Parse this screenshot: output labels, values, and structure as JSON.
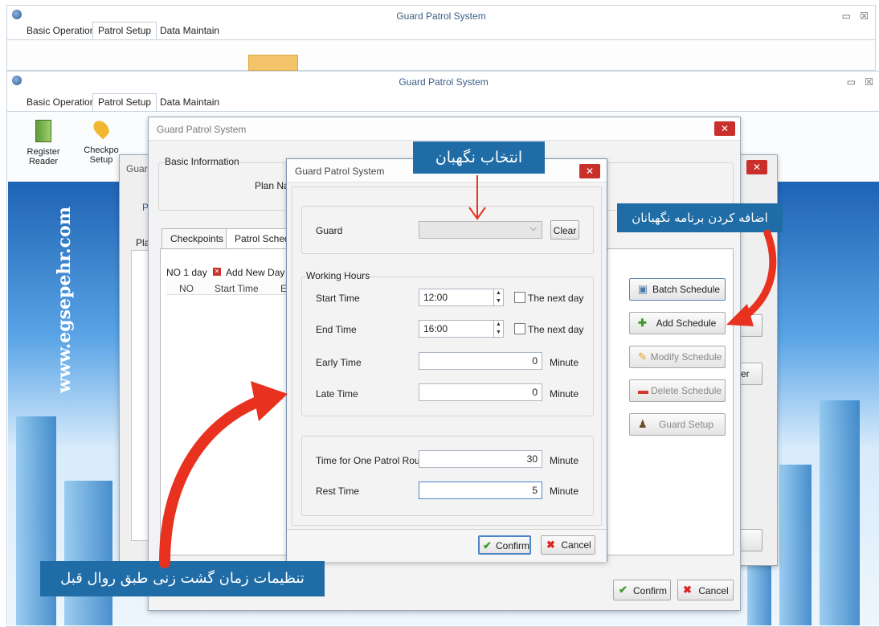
{
  "window_back": {
    "title": "Guard Patrol System",
    "menu": [
      "Basic Operation",
      "Patrol Setup",
      "Data Maintain"
    ]
  },
  "window_main": {
    "title": "Guard Patrol System",
    "menu": [
      "Basic Operation",
      "Patrol Setup",
      "Data Maintain"
    ],
    "ribbon": [
      {
        "label": "Register\nReader",
        "icon": "reader-icon"
      },
      {
        "label": "Checkpoint\nSetup",
        "icon": "checkpoint-pin-icon"
      }
    ],
    "ribbon_partial": [
      "Register",
      "Checkpo",
      "Reader",
      "Setup"
    ]
  },
  "plan_dialog": {
    "title": "Guard Patrol System",
    "basic_info_label": "Basic Information",
    "plan_name_label": "Plan Nar",
    "tabs": [
      "Checkpoints",
      "Patrol Schedu"
    ],
    "sched_tab_label": "NO 1 day",
    "add_new_day": "Add New Day",
    "columns": [
      "NO",
      "Start Time",
      "E"
    ],
    "side_buttons": [
      {
        "label": "Batch Schedule",
        "enabled": true,
        "icon": "batch-icon"
      },
      {
        "label": "Add Schedule",
        "enabled": true,
        "icon": "plus-icon"
      },
      {
        "label": "Modify Schedule",
        "enabled": false,
        "icon": "pencil-icon"
      },
      {
        "label": "Delete Schedule",
        "enabled": false,
        "icon": "minus-icon"
      },
      {
        "label": "Guard Setup",
        "enabled": false,
        "icon": "guard-icon"
      }
    ],
    "confirm": "Confirm",
    "cancel": "Cancel"
  },
  "mid_dialog": {
    "title": "Guard",
    "left_fragments": [
      "Pl",
      "Pla"
    ],
    "right_fragment": "er"
  },
  "guard_dialog": {
    "title": "Guard Patrol System",
    "guard_label": "Guard",
    "clear": "Clear",
    "working_hours": "Working Hours",
    "start_time_label": "Start Time",
    "start_time": "12:00",
    "end_time_label": "End Time",
    "end_time": "16:00",
    "next_day": "The next day",
    "early_time_label": "Early Time",
    "early_time": "0",
    "late_time_label": "Late Time",
    "late_time": "0",
    "round_label": "Time for One Patrol Round",
    "round": "30",
    "rest_label": "Rest Time",
    "rest": "5",
    "minute": "Minute",
    "confirm": "Confirm",
    "cancel": "Cancel"
  },
  "callouts": {
    "select_guard": "انتخاب نگهبان",
    "add_guard_schedule": "اضافه کردن برنامه نگهبانان",
    "patrol_time_settings": "تنظیمات زمان گشت زنی طبق روال قبل"
  },
  "watermark": "www.egsepehr.com",
  "colors": {
    "accent": "#1f6ca6",
    "arrow": "#e8321f",
    "close": "#c9302c"
  }
}
